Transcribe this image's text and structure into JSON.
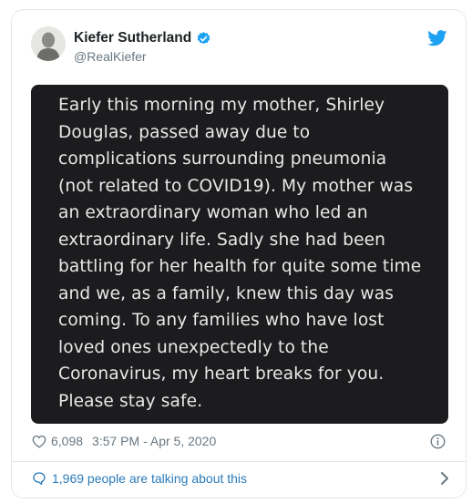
{
  "author": {
    "name": "Kiefer Sutherland",
    "handle": "@RealKiefer"
  },
  "tweet_image_text": [
    "Early this morning my mother, Shirley",
    "Douglas, passed away due to",
    "complications surrounding pneumonia",
    "(not related to COVID19). My mother was",
    "an extraordinary woman who led an",
    "extraordinary life. Sadly she had been",
    "battling for her health for quite some time",
    "and we, as a family, knew this day was",
    "coming. To any families who have lost",
    "loved ones unexpectedly to the",
    "Coronavirus, my heart breaks for you.",
    "Please stay safe."
  ],
  "meta": {
    "likes": "6,098",
    "timestamp": "3:57 PM - Apr 5, 2020"
  },
  "footer": {
    "talking": "1,969 people are talking about this"
  },
  "colors": {
    "link": "#2b7bb9",
    "twitter_blue": "#1da1f2",
    "muted": "#697882",
    "image_bg": "#1c1c1e"
  },
  "icons": [
    "verified-badge-icon",
    "twitter-bird-icon",
    "heart-icon",
    "info-icon",
    "speech-bubble-icon",
    "chevron-right-icon"
  ]
}
